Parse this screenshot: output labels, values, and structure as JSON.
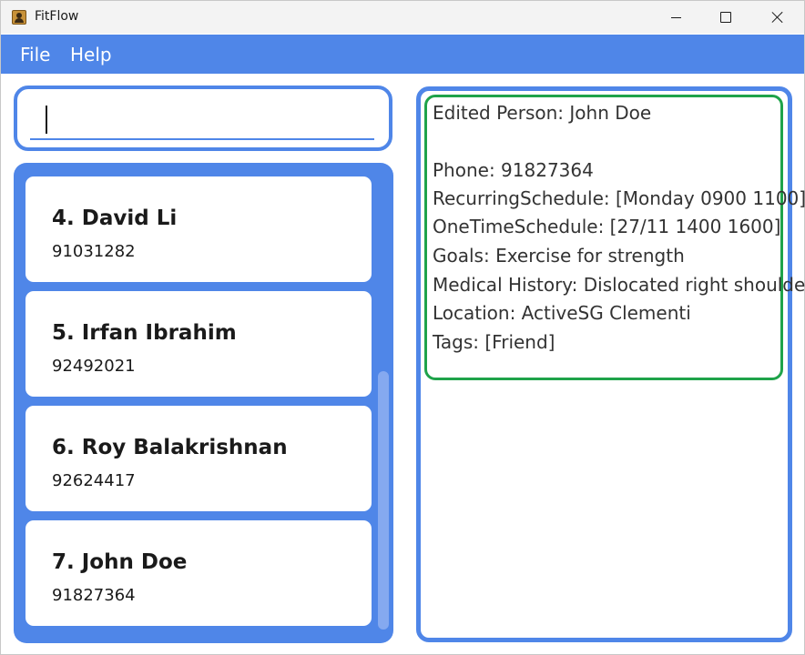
{
  "window": {
    "title": "FitFlow",
    "icon": "contact-card-icon",
    "controls": {
      "minimize": "minimize-icon",
      "maximize": "maximize-icon",
      "close": "close-icon"
    }
  },
  "menu": {
    "file": "File",
    "help": "Help"
  },
  "command": {
    "value": "",
    "placeholder": ""
  },
  "persons": [
    {
      "name": "4. David Li",
      "phone": "91031282"
    },
    {
      "name": "5. Irfan Ibrahim",
      "phone": "92492021"
    },
    {
      "name": "6. Roy Balakrishnan",
      "phone": "92624417"
    },
    {
      "name": "7. John Doe",
      "phone": "91827364"
    }
  ],
  "result": {
    "header": "Edited Person: John Doe",
    "phone": "Phone: 91827364",
    "recurring": "RecurringSchedule: [Monday 0900 1100]",
    "onetime": "OneTimeSchedule: [27/11 1400 1600]",
    "goals": "Goals: Exercise for strength",
    "medical": "Medical History: Dislocated right shoulder",
    "location": "Location: ActiveSG Clementi",
    "tags": "Tags: [Friend]"
  },
  "colors": {
    "accent": "#4f86e8",
    "success_border": "#1fa34a",
    "titlebar": "#f3f3f3"
  }
}
